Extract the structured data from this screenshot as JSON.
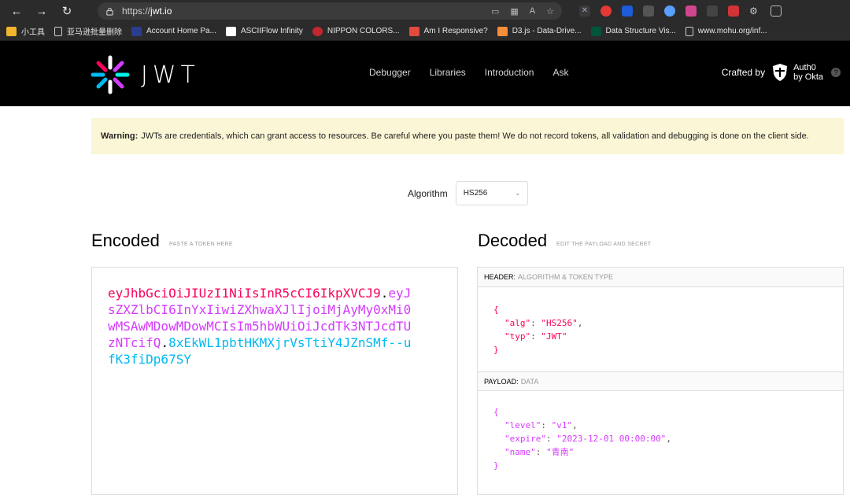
{
  "browser": {
    "url_scheme": "https://",
    "url_host": "jwt.io",
    "bookmarks": [
      {
        "label": "小工具",
        "icon": "folder-icon",
        "color": "#f2b52d"
      },
      {
        "label": "亚马逊批量删除",
        "icon": "page-icon",
        "color": "#cccccc"
      },
      {
        "label": "Account Home Pa...",
        "icon": "account-icon",
        "color": "#2a3d8f"
      },
      {
        "label": "ASCIIFlow Infinity",
        "icon": "asciiflow-icon",
        "color": "#ffffff"
      },
      {
        "label": "NIPPON COLORS...",
        "icon": "nippon-icon",
        "color": "#c1272d"
      },
      {
        "label": "Am I Responsive?",
        "icon": "responsive-icon",
        "color": "#e24b3b"
      },
      {
        "label": "D3.js - Data-Drive...",
        "icon": "d3-icon",
        "color": "#f68e3a"
      },
      {
        "label": "Data Structure Vis...",
        "icon": "usf-icon",
        "color": "#00543c"
      },
      {
        "label": "www.mohu.org/inf...",
        "icon": "page-icon",
        "color": "#cccccc"
      }
    ]
  },
  "header": {
    "logo_text": "JWT",
    "nav": [
      "Debugger",
      "Libraries",
      "Introduction",
      "Ask"
    ],
    "crafted_by": "Crafted by",
    "auth0_line1": "Auth0",
    "auth0_line2": "by Okta",
    "help": "?"
  },
  "warning": {
    "bold": "Warning:",
    "text": "JWTs are credentials, which can grant access to resources. Be careful where you paste them! We do not record tokens, all validation and debugging is done on the client side."
  },
  "algorithm": {
    "label": "Algorithm",
    "selected": "HS256"
  },
  "encoded": {
    "title": "Encoded",
    "subtitle": "PASTE A TOKEN HERE",
    "header_part": "eyJhbGciOiJIUzI1NiIsInR5cCI6IkpXVCJ9",
    "payload_part": "eyJsZXZlbCI6InYxIiwiZXhwaXJlIjoiMjAyMy0xMi0wMSAwMDowMDowMCIsIm5hbWUiOiJcdTk3NTJcdTUzNTcifQ",
    "signature_part": "8xEkWL1pbtHKMXjrVsTtiY4JZnSMf--ufK3fiDp67SY",
    "dot": "."
  },
  "decoded": {
    "title": "Decoded",
    "subtitle": "EDIT THE PAYLOAD AND SECRET",
    "header_label": "HEADER:",
    "header_desc": "ALGORITHM & TOKEN TYPE",
    "header_json": {
      "alg_key": "\"alg\"",
      "alg_val": "\"HS256\"",
      "typ_key": "\"typ\"",
      "typ_val": "\"JWT\""
    },
    "payload_label": "PAYLOAD:",
    "payload_desc": "DATA",
    "payload_json": {
      "level_key": "\"level\"",
      "level_val": "\"v1\"",
      "expire_key": "\"expire\"",
      "expire_val": "\"2023-12-01 00:00:00\"",
      "name_key": "\"name\"",
      "name_val": "\"青南\""
    }
  }
}
